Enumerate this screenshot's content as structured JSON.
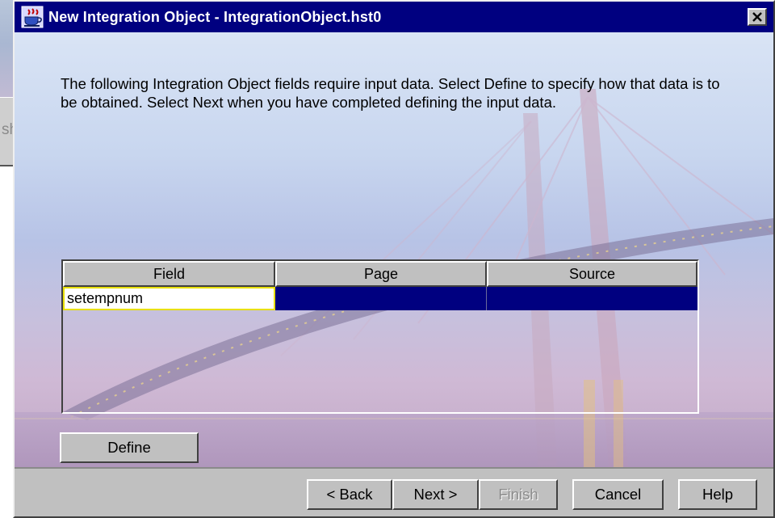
{
  "background_window": {
    "partial_text": "sh"
  },
  "window": {
    "title": "New Integration Object - IntegrationObject.hst0",
    "app_icon": "java-cup-icon",
    "close_icon": "close-icon"
  },
  "instructions": "The following Integration Object fields require input data. Select Define to specify how that data is to be obtained. Select Next when you have completed defining the input data.",
  "table": {
    "columns": [
      "Field",
      "Page",
      "Source"
    ],
    "rows": [
      {
        "field": "setempnum",
        "page": "",
        "source": ""
      }
    ],
    "selected_row": 0
  },
  "buttons": {
    "define": "Define",
    "back": "< Back",
    "next": "Next >",
    "finish": "Finish",
    "cancel": "Cancel",
    "help": "Help"
  },
  "colors": {
    "titlebar": "#000080",
    "selection": "#000080",
    "cell_focus_border": "#e8e000",
    "dialog_face": "#c0c0c0"
  }
}
